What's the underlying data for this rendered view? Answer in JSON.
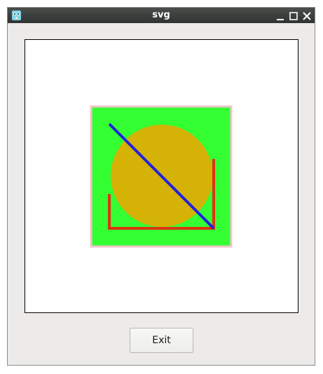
{
  "window": {
    "title": "svg",
    "icon": "gopher-app-icon",
    "controls": [
      "minimize-icon",
      "maximize-icon",
      "close-icon"
    ]
  },
  "drawing": {
    "background_color": "#33ff33",
    "border_color": "#f4c4cc",
    "circle_color": "#d4b206",
    "diagonal_line_color": "#2222dd",
    "bracket_line_color": "#dd3311"
  },
  "footer": {
    "exit_label": "Exit"
  }
}
